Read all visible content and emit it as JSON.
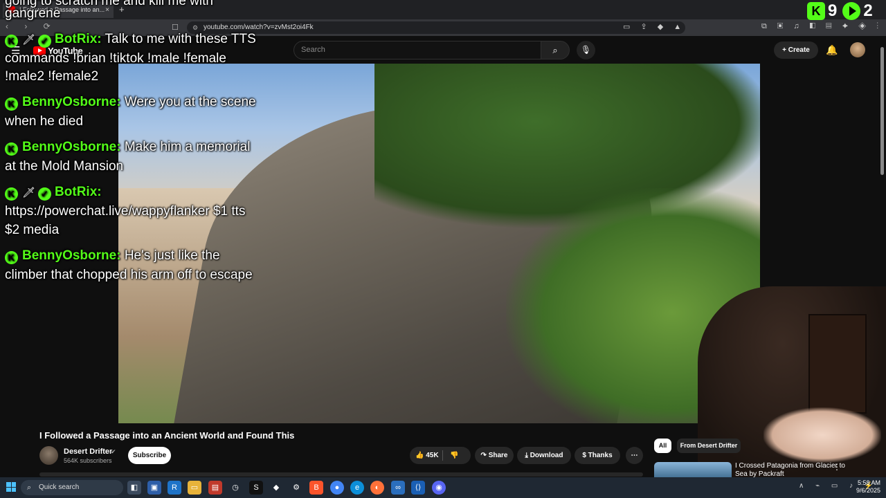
{
  "browser": {
    "tab_title": "I Followed a Passage into an...",
    "tab_close": "×",
    "new_tab": "+",
    "nav": "‹ › ⟳",
    "url": "youtube.com/watch?v=zvMst2oi4Fk"
  },
  "youtube": {
    "logo_text": "YouTube",
    "search_placeholder": "Search",
    "create_label": "+ Create"
  },
  "chat": {
    "top_partial": "going to scratch me and kill me with",
    "partial_line": "gangrene",
    "messages": [
      {
        "name": "BotRix:",
        "line1": "Talk to me with these TTS",
        "line2": "commands !brian !tiktok !male !female",
        "line3": "!male2 !female2"
      },
      {
        "name": "BennyOsborne:",
        "line1": "Were you at the scene",
        "line2": "when he died"
      },
      {
        "name": "BennyOsborne:",
        "line1": "Make him a memorial",
        "line2": "at the Mold Mansion"
      },
      {
        "name": "BotRix:",
        "line1": "",
        "line2": "https://powerchat.live/wappyflanker $1 tts",
        "line3": "$2 media"
      },
      {
        "name": "BennyOsborne:",
        "line1": "He's just like the",
        "line2": "climber that chopped his arm off to escape"
      }
    ]
  },
  "kick_stats": {
    "viewers": "9",
    "second": "2"
  },
  "video": {
    "title": "I Followed a Passage into an Ancient World and Found This",
    "channel": "Desert Drifter",
    "subscribers": "564K subscribers",
    "subscribe_label": "Subscribe",
    "likes": "45K",
    "share_label": "Share",
    "download_label": "Download",
    "thanks_label": "Thanks",
    "more_label": "⋯"
  },
  "sidebar": {
    "chip_all": "All",
    "chip_from": "From Desert Drifter",
    "rec_title": "I Crossed Patagonia from Glacier to Sea by Packraft"
  },
  "taskbar": {
    "search_label": "Quick search",
    "time": "5:58 AM",
    "date": "9/6/2025"
  }
}
